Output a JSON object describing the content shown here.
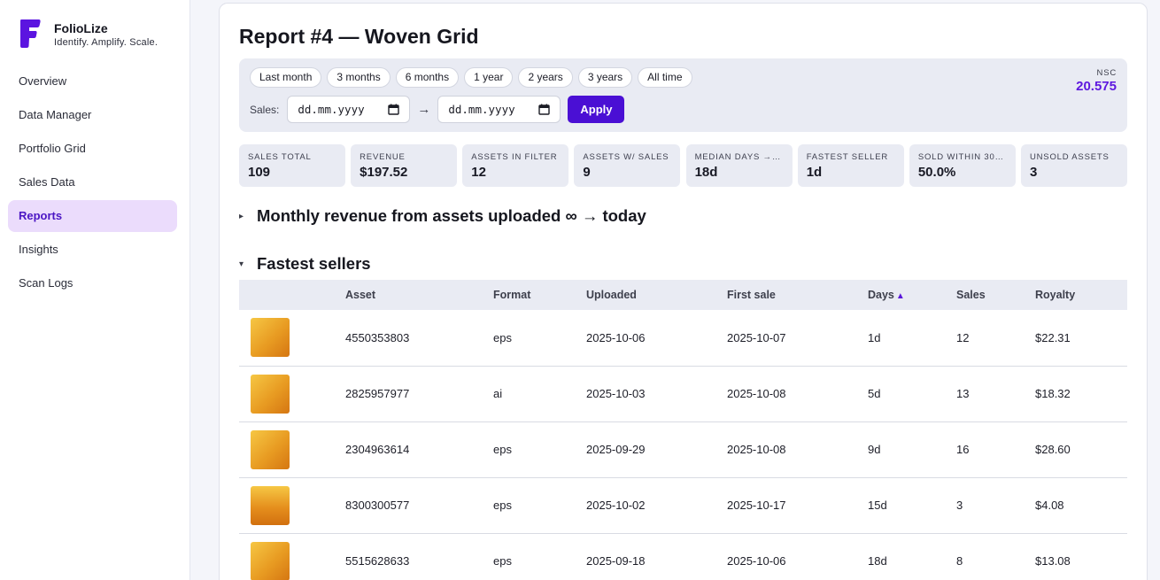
{
  "brand": {
    "name": "FolioLize",
    "tagline": "Identify. Amplify. Scale.",
    "logo_color": "#5b14e0"
  },
  "sidebar": {
    "items": [
      {
        "label": "Overview",
        "active": false
      },
      {
        "label": "Data Manager",
        "active": false
      },
      {
        "label": "Portfolio Grid",
        "active": false
      },
      {
        "label": "Sales Data",
        "active": false
      },
      {
        "label": "Reports",
        "active": true
      },
      {
        "label": "Insights",
        "active": false
      },
      {
        "label": "Scan Logs",
        "active": false
      }
    ]
  },
  "report": {
    "title": "Report #4 — Woven Grid"
  },
  "filters": {
    "ranges": [
      "Last month",
      "3 months",
      "6 months",
      "1 year",
      "2 years",
      "3 years",
      "All time"
    ],
    "sales_label": "Sales:",
    "date_from_placeholder": "dd.mm.yyyy",
    "date_to_placeholder": "dd.mm.yyyy",
    "arrow": "→",
    "apply_label": "Apply",
    "nsc_label": "NSC",
    "nsc_value": "20.575"
  },
  "stats": [
    {
      "label": "Sales total",
      "value": "109"
    },
    {
      "label": "Revenue",
      "value": "$197.52"
    },
    {
      "label": "Assets in filter",
      "value": "12"
    },
    {
      "label": "Assets w/ sales",
      "value": "9"
    },
    {
      "label": "Median days →…",
      "value": "18d"
    },
    {
      "label": "Fastest seller",
      "value": "1d"
    },
    {
      "label": "Sold within 30…",
      "value": "50.0%"
    },
    {
      "label": "Unsold assets",
      "value": "3"
    }
  ],
  "sections": {
    "monthly": {
      "toggle": "▸",
      "title": "Monthly revenue from assets uploaded ∞ → today"
    },
    "fastest": {
      "toggle": "▾",
      "title": "Fastest sellers"
    }
  },
  "table": {
    "headers": {
      "asset": "Asset",
      "format": "Format",
      "uploaded": "Uploaded",
      "first_sale": "First sale",
      "days": "Days",
      "days_sort": "▲",
      "sales": "Sales",
      "royalty": "Royalty"
    },
    "rows": [
      {
        "asset": "4550353803",
        "format": "eps",
        "uploaded": "2025-10-06",
        "first_sale": "2025-10-07",
        "days": "1d",
        "sales": "12",
        "royalty": "$22.31"
      },
      {
        "asset": "2825957977",
        "format": "ai",
        "uploaded": "2025-10-03",
        "first_sale": "2025-10-08",
        "days": "5d",
        "sales": "13",
        "royalty": "$18.32"
      },
      {
        "asset": "2304963614",
        "format": "eps",
        "uploaded": "2025-09-29",
        "first_sale": "2025-10-08",
        "days": "9d",
        "sales": "16",
        "royalty": "$28.60"
      },
      {
        "asset": "8300300577",
        "format": "eps",
        "uploaded": "2025-10-02",
        "first_sale": "2025-10-17",
        "days": "15d",
        "sales": "3",
        "royalty": "$4.08"
      },
      {
        "asset": "5515628633",
        "format": "eps",
        "uploaded": "2025-09-18",
        "first_sale": "2025-10-06",
        "days": "18d",
        "sales": "8",
        "royalty": "$13.08"
      }
    ]
  }
}
